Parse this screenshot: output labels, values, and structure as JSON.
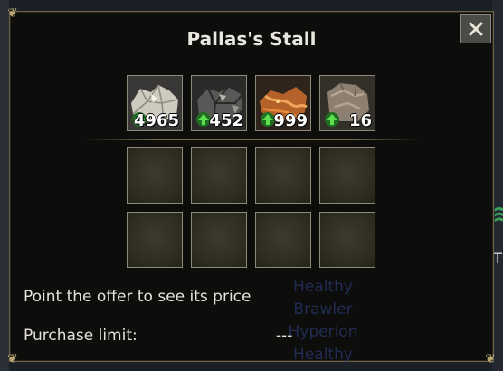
{
  "window": {
    "title": "Pallas's Stall",
    "close_label": "✕"
  },
  "offers": [
    {
      "icon": "silver-ore-icon",
      "quantity": "4965"
    },
    {
      "icon": "iron-ore-icon",
      "quantity": "452"
    },
    {
      "icon": "copper-ore-icon",
      "quantity": "999"
    },
    {
      "icon": "stone-ore-icon",
      "quantity": "16"
    }
  ],
  "empty_slots": 8,
  "info": {
    "hint": "Point the offer to see its price",
    "purchase_limit_label": "Purchase limit:",
    "purchase_limit_value": "---"
  },
  "background": {
    "overlay_lines": [
      "Healthy",
      "Brawler",
      "Hyperion",
      "Healthy"
    ],
    "right_letter": "T"
  },
  "colors": {
    "window_bg": "#0d0d0c",
    "border_gold": "#6d6243",
    "upgrade_green": "#3dbb3a"
  }
}
